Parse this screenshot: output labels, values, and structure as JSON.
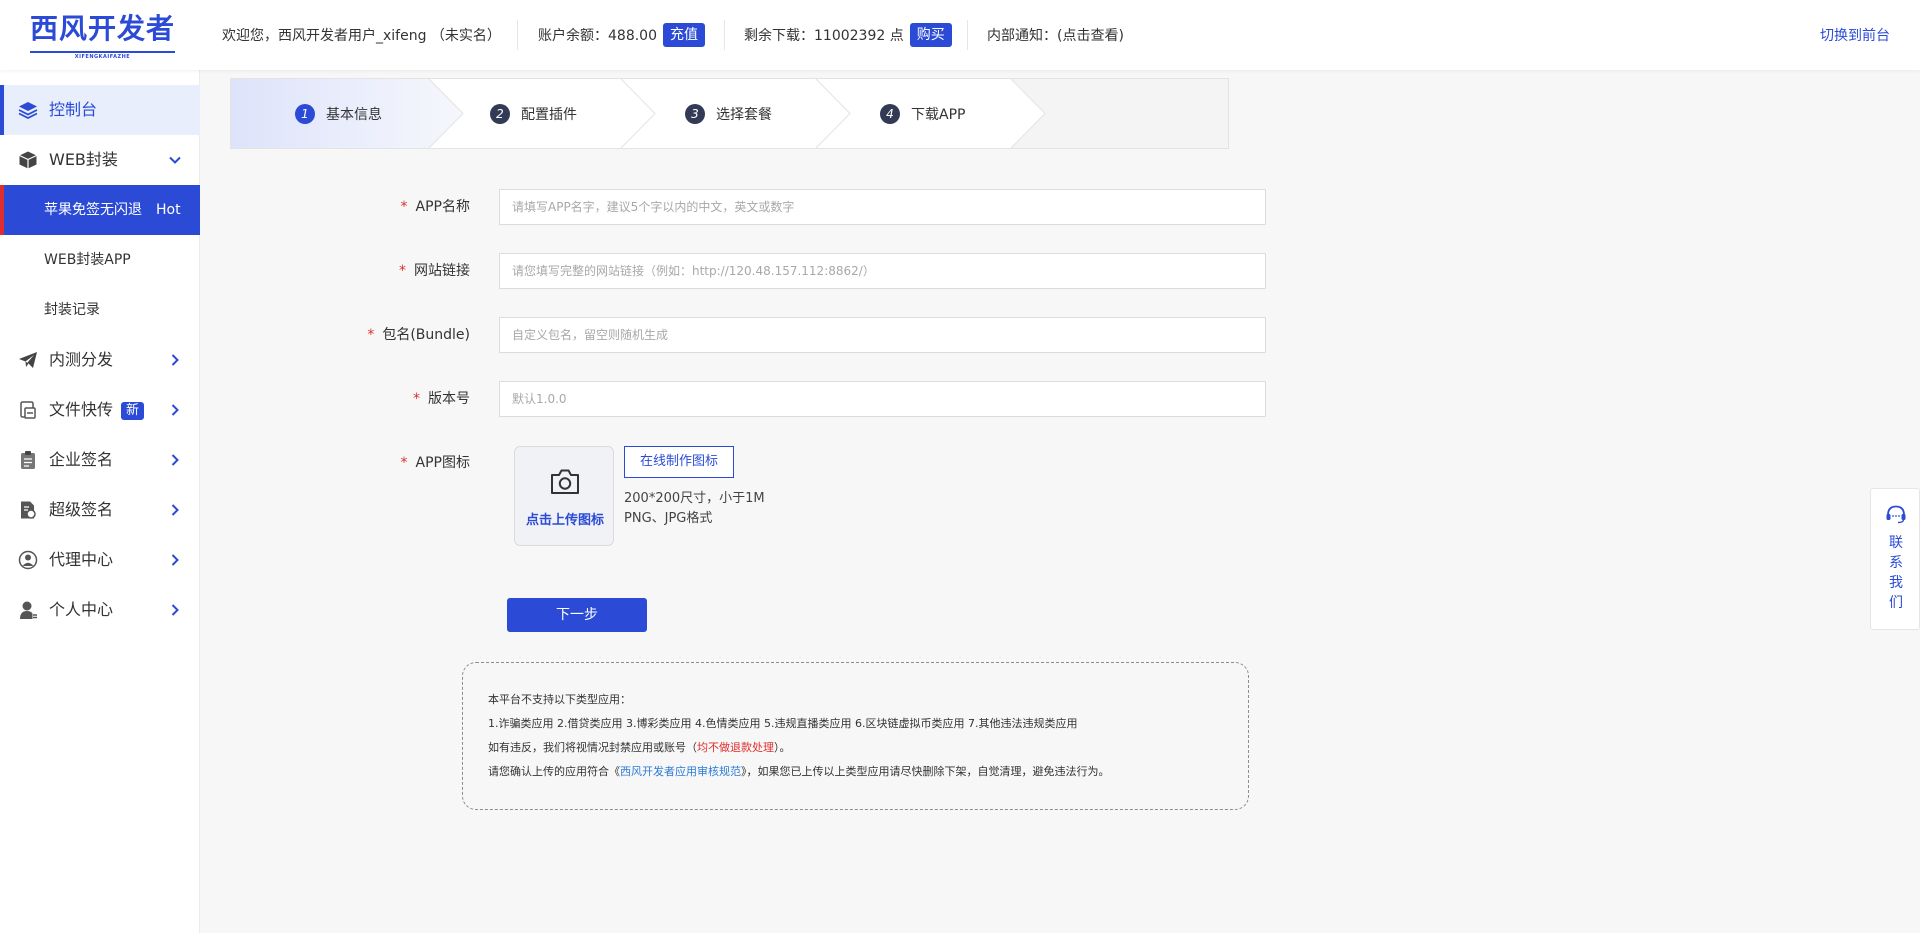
{
  "header": {
    "logo_text": "西风开发者",
    "logo_sub": "XIFENGKAIFAZHE",
    "welcome": "欢迎您，西风开发者用户_xifeng （未实名）",
    "balance_label": "账户余额：488.00",
    "recharge_btn": "充值",
    "downloads_label": "剩余下载：11002392 点",
    "buy_btn": "购买",
    "notice": "内部通知：(点击查看)",
    "switch_front": "切换到前台"
  },
  "sidebar": {
    "console": "控制台",
    "web_pack": "WEB封装",
    "sub_items": {
      "apple": "苹果免签无闪退",
      "apple_badge": "Hot",
      "web_app": "WEB封装APP",
      "records": "封装记录"
    },
    "beta": "内测分发",
    "file_transfer": "文件快传",
    "file_badge": "新",
    "enterprise_sign": "企业签名",
    "super_sign": "超级签名",
    "agent": "代理中心",
    "personal": "个人中心"
  },
  "steps": [
    {
      "num": "1",
      "label": "基本信息"
    },
    {
      "num": "2",
      "label": "配置插件"
    },
    {
      "num": "3",
      "label": "选择套餐"
    },
    {
      "num": "4",
      "label": "下载APP"
    }
  ],
  "form": {
    "required_mark": "*",
    "app_name_label": "APP名称",
    "app_name_placeholder": "请填写APP名字，建议5个字以内的中文，英文或数字",
    "url_label": "网站链接",
    "url_placeholder": "请您填写完整的网站链接（例如：http://120.48.157.112:8862/）",
    "bundle_label": "包名(Bundle)",
    "bundle_placeholder": "自定义包名，留空则随机生成",
    "version_label": "版本号",
    "version_placeholder": "默认1.0.0",
    "icon_label": "APP图标",
    "upload_label": "点击上传图标",
    "make_icon_btn": "在线制作图标",
    "size_hint": "200*200尺寸，小于1M",
    "format_hint": "PNG、JPG格式",
    "next_btn": "下一步"
  },
  "notice": {
    "line1": "本平台不支持以下类型应用：",
    "line2": "1.诈骗类应用 2.借贷类应用 3.博彩类应用 4.色情类应用 5.违规直播类应用 6.区块链虚拟币类应用 7.其他违法违规类应用",
    "line3_prefix": "如有违反，我们将视情况封禁应用或账号（",
    "line3_red": "均不做退款处理",
    "line3_suffix": "）。",
    "line4_prefix": "请您确认上传的应用符合《",
    "line4_link": "西风开发者应用审核规范",
    "line4_suffix": "》，如果您已上传以上类型应用请尽快删除下架，自觉清理，避免违法行为。"
  },
  "contact": {
    "label": "联系我们"
  },
  "colors": {
    "accent": "#2b4bd6",
    "danger": "#e02d2d",
    "link": "#2b7bd6"
  }
}
